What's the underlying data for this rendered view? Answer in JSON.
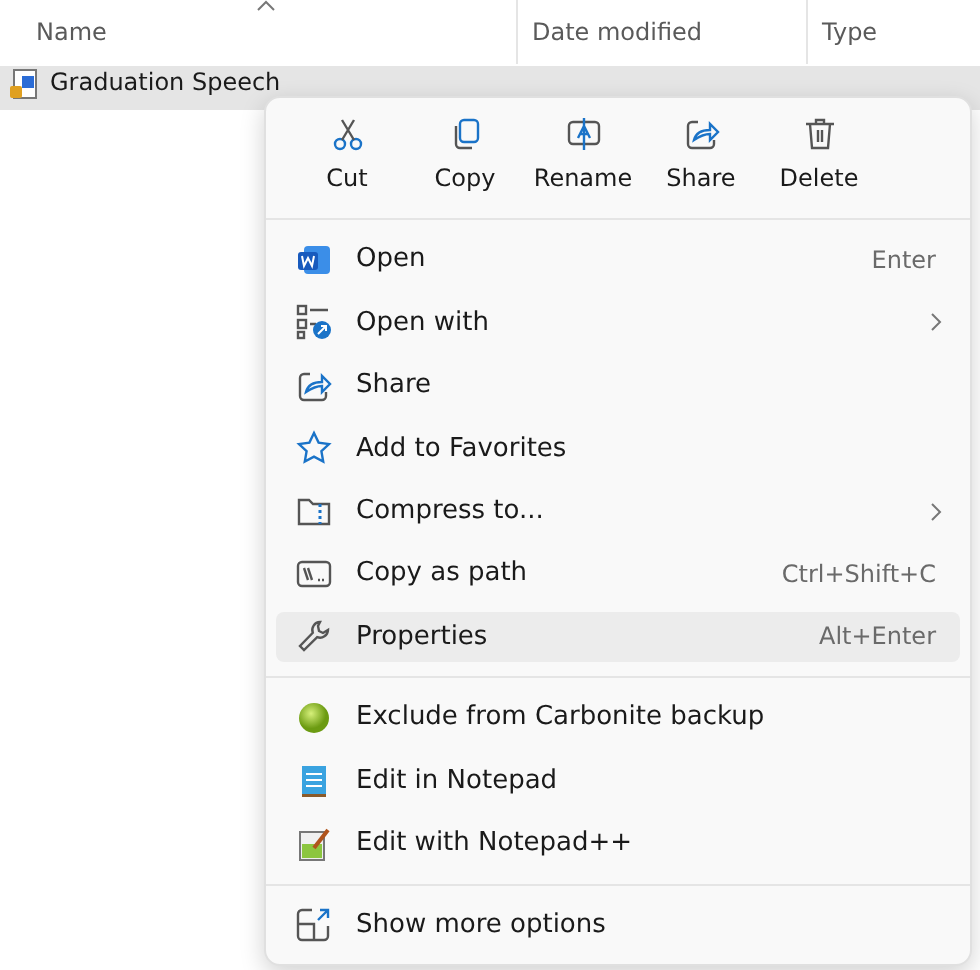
{
  "columns": [
    {
      "label": "Name",
      "sorted": true
    },
    {
      "label": "Date modified",
      "sorted": false
    },
    {
      "label": "Type",
      "sorted": false
    }
  ],
  "file": {
    "name": "Graduation Speech",
    "selected": true
  },
  "toolbar": [
    {
      "label": "Cut"
    },
    {
      "label": "Copy"
    },
    {
      "label": "Rename"
    },
    {
      "label": "Share"
    },
    {
      "label": "Delete"
    }
  ],
  "groups": [
    [
      {
        "label": "Open",
        "shortcut": "Enter",
        "submenu": false,
        "selected": false
      },
      {
        "label": "Open with",
        "submenu": true,
        "selected": false
      },
      {
        "label": "Share",
        "submenu": false,
        "selected": false
      },
      {
        "label": "Add to Favorites",
        "submenu": false,
        "selected": false
      },
      {
        "label": "Compress to...",
        "submenu": true,
        "selected": false
      },
      {
        "label": "Copy as path",
        "shortcut": "Ctrl+Shift+C",
        "submenu": false,
        "selected": false
      },
      {
        "label": "Properties",
        "shortcut": "Alt+Enter",
        "submenu": false,
        "selected": true
      }
    ],
    [
      {
        "label": "Exclude from Carbonite backup",
        "submenu": false,
        "selected": false
      },
      {
        "label": "Edit in Notepad",
        "submenu": false,
        "selected": false
      },
      {
        "label": "Edit with Notepad++",
        "submenu": false,
        "selected": false
      }
    ],
    [
      {
        "label": "Show more options",
        "submenu": false,
        "selected": false
      }
    ]
  ]
}
